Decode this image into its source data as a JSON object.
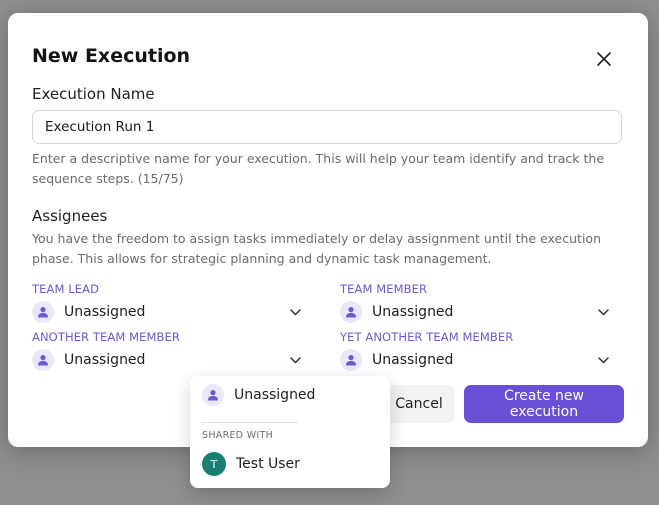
{
  "modal": {
    "title": "New Execution",
    "close_icon": "close-icon"
  },
  "execution_name": {
    "label": "Execution Name",
    "value": "Execution Run 1",
    "help": "Enter a descriptive name for your execution. This will help your team identify and track the sequence steps. (15/75)"
  },
  "assignees": {
    "label": "Assignees",
    "help": "You have the freedom to assign tasks immediately or delay assignment until the execution phase. This allows for strategic planning and dynamic task management.",
    "fields": [
      {
        "label": "TEAM LEAD",
        "value": "Unassigned"
      },
      {
        "label": "TEAM MEMBER",
        "value": "Unassigned"
      },
      {
        "label": "ANOTHER TEAM MEMBER",
        "value": "Unassigned"
      },
      {
        "label": "YET ANOTHER TEAM MEMBER",
        "value": "Unassigned"
      }
    ]
  },
  "buttons": {
    "cancel": "Cancel",
    "create": "Create new execution"
  },
  "dropdown": {
    "unassigned": "Unassigned",
    "section_label": "SHARED WITH",
    "users": [
      {
        "initial": "T",
        "name": "Test User"
      }
    ]
  },
  "colors": {
    "accent": "#6a4fd4",
    "label_purple": "#6a5acd",
    "avatar_bg": "#ebe7fb",
    "user_avatar": "#1a7f72",
    "backdrop": "#8e8e8e"
  }
}
